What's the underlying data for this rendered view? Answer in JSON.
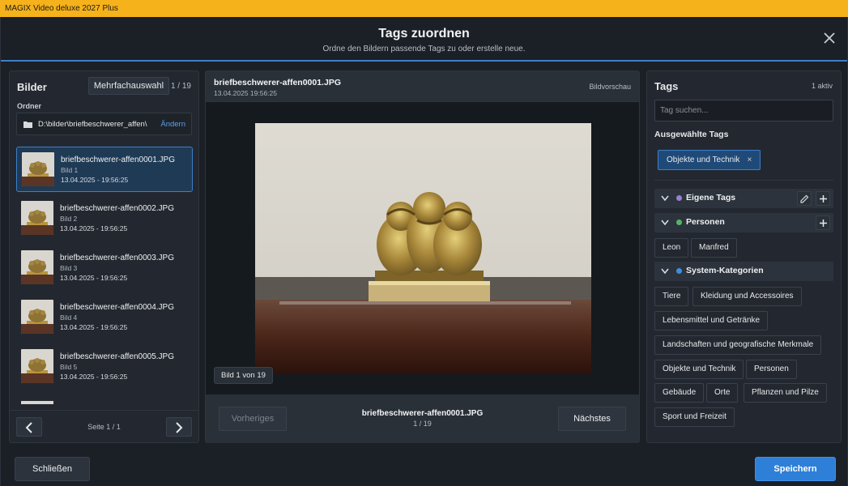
{
  "window": {
    "title": "MAGIX Video deluxe 2027 Plus"
  },
  "dialog": {
    "title": "Tags zuordnen",
    "subtitle": "Ordne den Bildern passende Tags zu oder erstelle neue."
  },
  "left": {
    "title": "Bilder",
    "multi_select_label": "Mehrfachauswahl",
    "count": "1 / 19",
    "folder_label": "Ordner",
    "folder_path": "D:\\bilder\\briefbeschwerer_affen\\",
    "folder_change": "Ändern",
    "items": [
      {
        "name": "briefbeschwerer-affen0001.JPG",
        "sub": "Bild 1",
        "date": "13.04.2025 - 19:56:25",
        "active": true
      },
      {
        "name": "briefbeschwerer-affen0002.JPG",
        "sub": "Bild 2",
        "date": "13.04.2025 - 19:56:25"
      },
      {
        "name": "briefbeschwerer-affen0003.JPG",
        "sub": "Bild 3",
        "date": "13.04.2025 - 19:56:25"
      },
      {
        "name": "briefbeschwerer-affen0004.JPG",
        "sub": "Bild 4",
        "date": "13.04.2025 - 19:56:25"
      },
      {
        "name": "briefbeschwerer-affen0005.JPG",
        "sub": "Bild 5",
        "date": "13.04.2025 - 19:56:25"
      }
    ],
    "page_text": "Seite 1 / 1"
  },
  "center": {
    "file_name": "briefbeschwerer-affen0001.JPG",
    "file_date": "13.04.2025 19:56:25",
    "preview_label": "Bildvorschau",
    "image_counter": "Bild 1 von 19",
    "prev_label": "Vorheriges",
    "next_label": "Nächstes",
    "footer_name": "briefbeschwerer-affen0001.JPG",
    "footer_pos": "1 / 19"
  },
  "right": {
    "title": "Tags",
    "active_count": "1 aktiv",
    "search_placeholder": "Tag suchen...",
    "selected_title": "Ausgewählte Tags",
    "selected_tags": [
      "Objekte und Technik"
    ],
    "categories": {
      "own": {
        "label": "Eigene Tags",
        "color": "#9b7fd4"
      },
      "persons": {
        "label": "Personen",
        "color": "#55b567",
        "tags": [
          "Leon",
          "Manfred"
        ]
      },
      "system": {
        "label": "System-Kategorien",
        "color": "#3d8fe0",
        "tags": [
          "Tiere",
          "Kleidung und Accessoires",
          "Lebensmittel und Getränke",
          "Landschaften und geografische Merkmale",
          "Objekte und Technik",
          "Personen",
          "Gebäude",
          "Orte",
          "Pflanzen und Pilze",
          "Sport und Freizeit"
        ]
      }
    }
  },
  "footer": {
    "close_label": "Schließen",
    "save_label": "Speichern"
  },
  "colors": {
    "accent": "#2e7fd8",
    "titlebar": "#f6b21b"
  }
}
